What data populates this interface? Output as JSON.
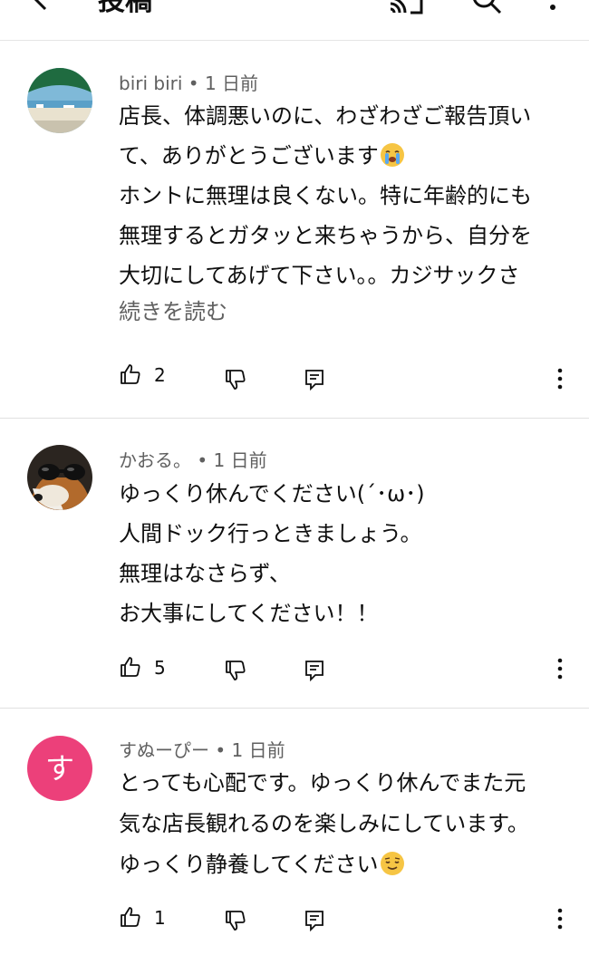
{
  "header": {
    "title": "投稿"
  },
  "comments": [
    {
      "author": "biri biri",
      "time": "1 日前",
      "lines": [
        "店長、体調悪いのに、わざわざご報告頂い",
        "て、ありがとうございます",
        "ホントに無理は良くない。特に年齢的にも",
        "無理するとガタッと来ちゃうから、自分を",
        "大切にしてあげて下さい。。カジサックさ"
      ],
      "read_more": "続きを読む",
      "likes": "2",
      "avatar": "beach-photo",
      "emoji": "loudly-crying-face"
    },
    {
      "author": "かおる。",
      "time": "1 日前",
      "lines": [
        "ゆっくり休んでください(´･ω･)",
        "人間ドック行っときましょう。",
        "無理はなさらず、",
        "お大事にしてください！！"
      ],
      "likes": "5",
      "avatar": "dog-with-sunglasses-photo"
    },
    {
      "author": "すぬーぴー",
      "time": "1 日前",
      "lines": [
        "とっても心配です。ゆっくり休んでまた元",
        "気な店長観れるのを楽しみにしています。",
        "ゆっくり静養してください"
      ],
      "likes": "1",
      "avatar_letter": "す",
      "avatar_color": "#ec407a",
      "emoji": "relieved-face"
    }
  ]
}
